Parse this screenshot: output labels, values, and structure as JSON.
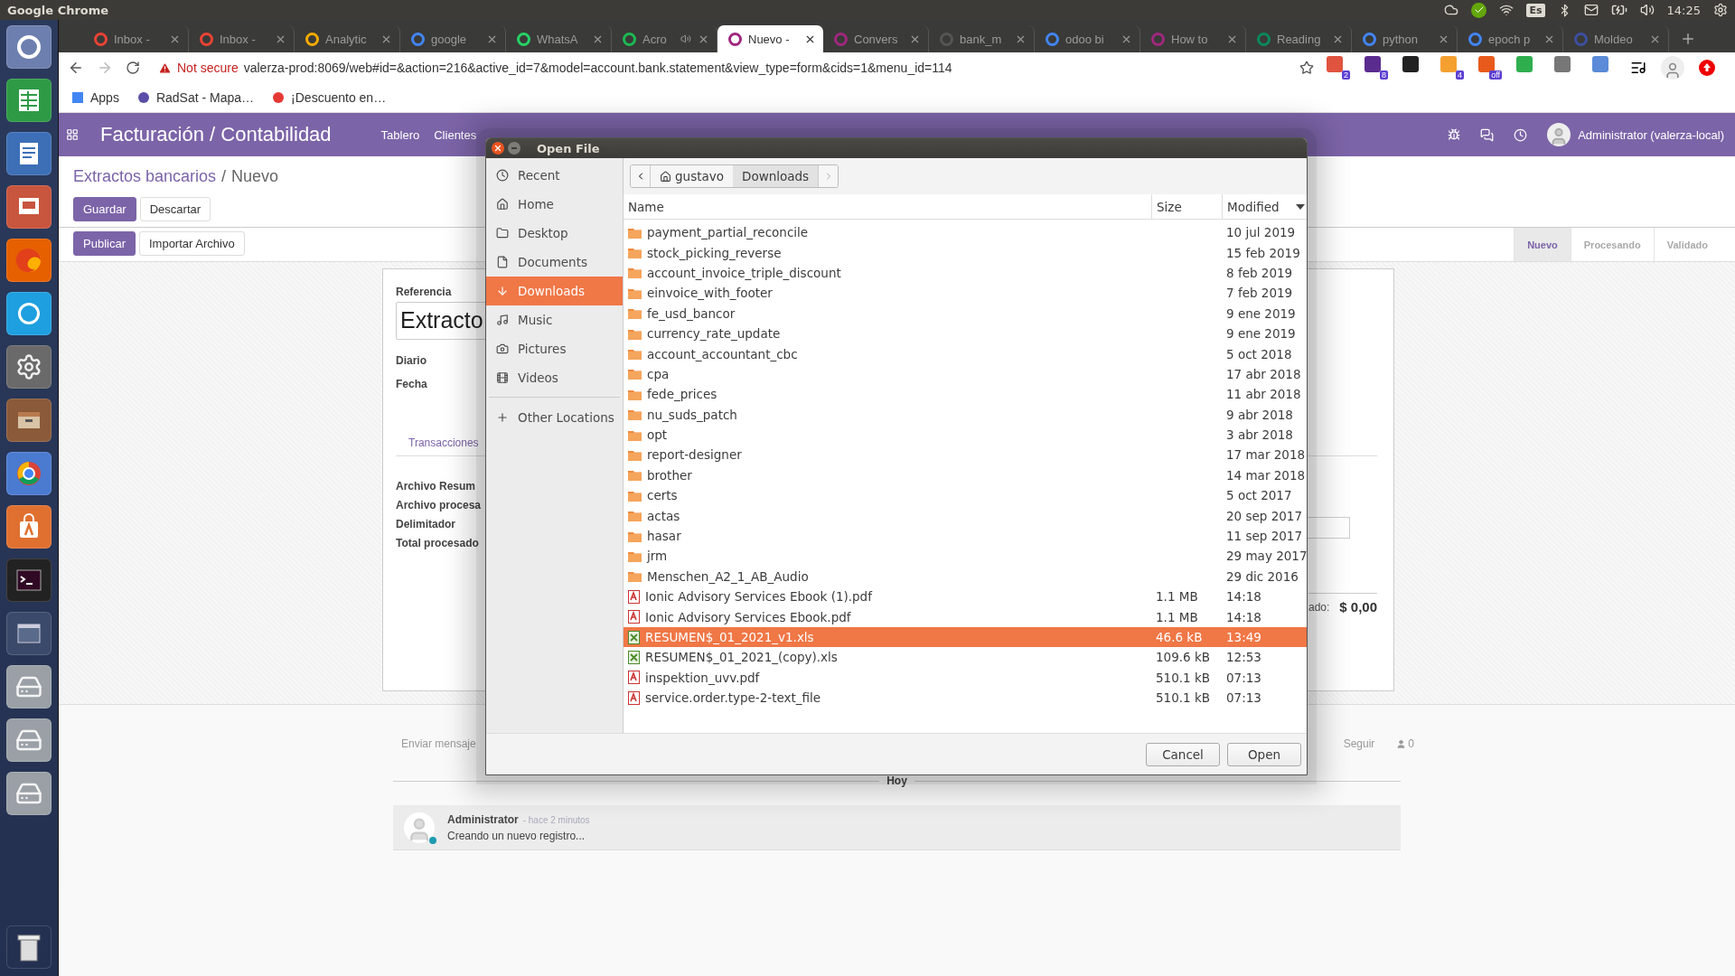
{
  "desktop": {
    "title": "Google Chrome",
    "keyboard": "Es",
    "clock": "14:25"
  },
  "browser": {
    "tabs": [
      {
        "title": "Inbox -",
        "color": "#ea4335",
        "audio": false,
        "selected": false
      },
      {
        "title": "Inbox -",
        "color": "#ea4335",
        "audio": false,
        "selected": false
      },
      {
        "title": "Analytic",
        "color": "#f9ab00",
        "audio": false,
        "selected": false
      },
      {
        "title": "google",
        "color": "#4285f4",
        "audio": false,
        "selected": false
      },
      {
        "title": "WhatsA",
        "color": "#25d366",
        "audio": false,
        "selected": false
      },
      {
        "title": "Acro",
        "color": "#1db954",
        "audio": true,
        "selected": false
      },
      {
        "title": "Nuevo -",
        "color": "#a0287f",
        "audio": false,
        "selected": true
      },
      {
        "title": "Convers",
        "color": "#a0287f",
        "audio": false,
        "selected": false
      },
      {
        "title": "bank_m",
        "color": "#555555",
        "audio": false,
        "selected": false
      },
      {
        "title": "odoo bi",
        "color": "#4285f4",
        "audio": false,
        "selected": false
      },
      {
        "title": "How to",
        "color": "#a0287f",
        "audio": false,
        "selected": false
      },
      {
        "title": "Reading",
        "color": "#0a8a5a",
        "audio": false,
        "selected": false
      },
      {
        "title": "python",
        "color": "#4285f4",
        "audio": false,
        "selected": false
      },
      {
        "title": "epoch p",
        "color": "#4285f4",
        "audio": false,
        "selected": false
      },
      {
        "title": "Moldeo",
        "color": "#3d4fa0",
        "audio": false,
        "selected": false
      }
    ],
    "address": {
      "warning": "Not secure",
      "url": "valerza-prod:8069/web#id=&action=216&active_id=7&model=account.bank.statement&view_type=form&cids=1&menu_id=114"
    },
    "extensions": [
      {
        "badge": "2",
        "color": "#e0533f"
      },
      {
        "badge": "8",
        "color": "#5b2c8f"
      },
      {
        "color": "#222222"
      },
      {
        "badge": "4",
        "color": "#f4a030"
      },
      {
        "badge": "off",
        "color": "#e85a1c"
      },
      {
        "color": "#2fae4e"
      },
      {
        "color": "#777777"
      },
      {
        "color": "#5a8ad8"
      }
    ],
    "bookmarks": [
      "Apps",
      "RadSat - Mapa…",
      "¡Descuento en…"
    ]
  },
  "odoo": {
    "app_title": "Facturación / Contabilidad",
    "menu": [
      "Tablero",
      "Clientes"
    ],
    "user": "Administrator (valerza-local)",
    "breadcrumb": [
      "Extractos bancarios",
      "Nuevo"
    ],
    "breadcrumb_separator": "/",
    "buttons": [
      {
        "label": "Guardar",
        "primary": true
      },
      {
        "label": "Descartar",
        "primary": false
      }
    ],
    "actions": [
      {
        "label": "Publicar",
        "primary": true
      },
      {
        "label": "Importar Archivo",
        "primary": false
      }
    ],
    "stages": [
      {
        "label": "Nuevo",
        "selected": true
      },
      {
        "label": "Procesando",
        "selected": false
      },
      {
        "label": "Validado",
        "selected": false
      }
    ],
    "form": {
      "reference_label": "Referencia",
      "reference_value": "Extracto",
      "fields": [
        "Diario",
        "Fecha"
      ],
      "tab": "Transacciones",
      "extra_fields": [
        "Archivo Resum",
        "Archivo procesa",
        "Delimitador",
        "Total procesado"
      ],
      "total_label": "ado:",
      "total_value": "$ 0,00"
    },
    "chatter": {
      "send": "Enviar mensaje",
      "follow": "Seguir",
      "followers": "0",
      "day": "Hoy",
      "message": {
        "author": "Administrator",
        "time": "- hace 2 minutos",
        "body": "Creando un nuevo registro..."
      }
    }
  },
  "dialog": {
    "title": "Open File",
    "places": [
      {
        "label": "Recent",
        "selected": false
      },
      {
        "label": "Home",
        "selected": false
      },
      {
        "label": "Desktop",
        "selected": false
      },
      {
        "label": "Documents",
        "selected": false
      },
      {
        "label": "Downloads",
        "selected": true
      },
      {
        "label": "Music",
        "selected": false
      },
      {
        "label": "Pictures",
        "selected": false
      },
      {
        "label": "Videos",
        "selected": false
      }
    ],
    "other_locations": "Other Locations",
    "path": [
      {
        "label": "gustavo",
        "selected": false
      },
      {
        "label": "Downloads",
        "selected": true
      }
    ],
    "columns": [
      "Name",
      "Size",
      "Modified"
    ],
    "files": [
      {
        "kind": "folder",
        "name": "payment_partial_reconcile",
        "modified": "10 jul 2019",
        "selected": false
      },
      {
        "kind": "folder",
        "name": "stock_picking_reverse",
        "modified": "15 feb 2019",
        "selected": false
      },
      {
        "kind": "folder",
        "name": "account_invoice_triple_discount",
        "modified": "8 feb 2019",
        "selected": false
      },
      {
        "kind": "folder",
        "name": "einvoice_with_footer",
        "modified": "7 feb 2019",
        "selected": false
      },
      {
        "kind": "folder",
        "name": "fe_usd_bancor",
        "modified": "9 ene 2019",
        "selected": false
      },
      {
        "kind": "folder",
        "name": "currency_rate_update",
        "modified": "9 ene 2019",
        "selected": false
      },
      {
        "kind": "folder",
        "name": "account_accountant_cbc",
        "modified": "5 oct 2018",
        "selected": false
      },
      {
        "kind": "folder",
        "name": "cpa",
        "modified": "17 abr 2018",
        "selected": false
      },
      {
        "kind": "folder",
        "name": "fede_prices",
        "modified": "11 abr 2018",
        "selected": false
      },
      {
        "kind": "folder",
        "name": "nu_suds_patch",
        "modified": "9 abr 2018",
        "selected": false
      },
      {
        "kind": "folder",
        "name": "opt",
        "modified": "3 abr 2018",
        "selected": false
      },
      {
        "kind": "folder",
        "name": "report-designer",
        "modified": "17 mar 2018",
        "selected": false
      },
      {
        "kind": "folder",
        "name": "brother",
        "modified": "14 mar 2018",
        "selected": false
      },
      {
        "kind": "folder",
        "name": "certs",
        "modified": "5 oct 2017",
        "selected": false
      },
      {
        "kind": "folder",
        "name": "actas",
        "modified": "20 sep 2017",
        "selected": false
      },
      {
        "kind": "folder",
        "name": "hasar",
        "modified": "11 sep 2017",
        "selected": false
      },
      {
        "kind": "folder",
        "name": "jrm",
        "modified": "29 may 2017",
        "selected": false
      },
      {
        "kind": "folder",
        "name": "Menschen_A2_1_AB_Audio",
        "modified": "29 dic 2016",
        "selected": false
      },
      {
        "kind": "pdf",
        "name": "Ionic Advisory Services Ebook (1).pdf",
        "size": "1.1 MB",
        "modified": "14:18",
        "selected": false
      },
      {
        "kind": "pdf",
        "name": "Ionic Advisory Services Ebook.pdf",
        "size": "1.1 MB",
        "modified": "14:18",
        "selected": false
      },
      {
        "kind": "sheet",
        "name": "RESUMEN$_01_2021_v1.xls",
        "size": "46.6 kB",
        "modified": "13:49",
        "selected": true
      },
      {
        "kind": "sheet",
        "name": "RESUMEN$_01_2021_(copy).xls",
        "size": "109.6 kB",
        "modified": "12:53",
        "selected": false
      },
      {
        "kind": "pdf",
        "name": "inspektion_uvv.pdf",
        "size": "510.1 kB",
        "modified": "07:13",
        "selected": false
      },
      {
        "kind": "pdf",
        "name": "service.order.type-2-text_file",
        "size": "510.1 kB",
        "modified": "07:13",
        "selected": false
      }
    ],
    "buttons": [
      "Cancel",
      "Open"
    ]
  }
}
